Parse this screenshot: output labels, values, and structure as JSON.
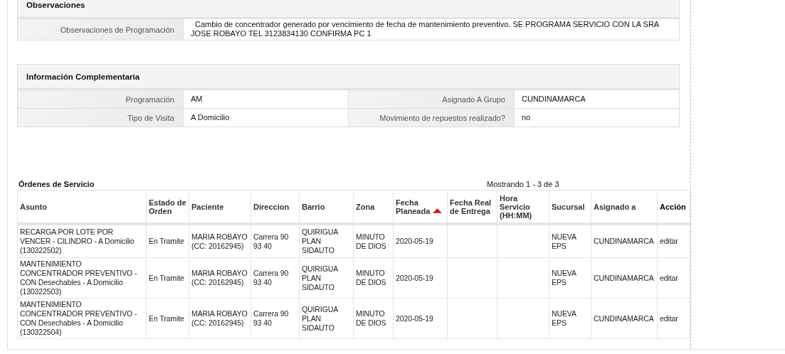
{
  "observaciones": {
    "title": "Observaciones",
    "fields": [
      {
        "label": "Observaciones de Programación",
        "value": "Cambio de concentrador generado por vencimiento de fecha de mantenimiento preventivo. SE PROGRAMA SERVICIO CON LA SRA JOSE ROBAYO TEL 3123834130 CONFIRMA PC 1"
      }
    ]
  },
  "informacion_complementaria": {
    "title": "Información Complementaria",
    "fields": [
      {
        "label": "Programación",
        "value": "AM"
      },
      {
        "label": "Asignado A Grupo",
        "value": "CUNDINAMARCA"
      },
      {
        "label": "Tipo de Visita",
        "value": "A Domicilio"
      },
      {
        "label": "Movimiento de repuestos realizado?",
        "value": "no"
      }
    ]
  },
  "ordenes": {
    "title": "Órdenes de Servicio",
    "pagination": "Mostrando 1 - 3 de 3",
    "columns": [
      {
        "label": "Asunto",
        "sortable": true,
        "sorted": false
      },
      {
        "label": "Estado de Orden",
        "sortable": true,
        "sorted": false
      },
      {
        "label": "Paciente",
        "sortable": true,
        "sorted": false
      },
      {
        "label": "Direccion",
        "sortable": true,
        "sorted": false
      },
      {
        "label": "Barrio",
        "sortable": true,
        "sorted": false
      },
      {
        "label": "Zona",
        "sortable": true,
        "sorted": false
      },
      {
        "label": "Fecha Planeada",
        "sortable": true,
        "sorted": true
      },
      {
        "label": "Fecha Real de Entrega",
        "sortable": true,
        "sorted": false
      },
      {
        "label": "Hora Servicio (HH:MM)",
        "sortable": true,
        "sorted": false
      },
      {
        "label": "Sucursal",
        "sortable": true,
        "sorted": false
      },
      {
        "label": "Asignado a",
        "sortable": true,
        "sorted": false
      },
      {
        "label": "Acción",
        "sortable": false,
        "sorted": false
      }
    ],
    "rows": [
      [
        "RECARGA POR LOTE POR VENCER - CILINDRO - A Domicilio (130322502)",
        "En Tramite",
        "MARIA ROBAYO (CC: 20162945)",
        "Carrera 90 93 40",
        "QUIRIGUA PLAN SIDAUTO",
        "MINUTO DE DIOS",
        "2020-05-19",
        "",
        "",
        "NUEVA EPS",
        "CUNDINAMARCA",
        "editar"
      ],
      [
        "MANTENIMIENTO CONCENTRADOR PREVENTIVO - CON Desechables - A Domicilio (130322503)",
        "En Tramite",
        "MARIA ROBAYO (CC: 20162945)",
        "Carrera 90 93 40",
        "QUIRIGUA PLAN SIDAUTO",
        "MINUTO DE DIOS",
        "2020-05-19",
        "",
        "",
        "NUEVA EPS",
        "CUNDINAMARCA",
        "editar"
      ],
      [
        "MANTENIMIENTO CONCENTRADOR PREVENTIVO - CON Desechables - A Domicilio (130322504)",
        "En Tramite",
        "MARIA ROBAYO (CC: 20162945)",
        "Carrera 90 93 40",
        "QUIRIGUA PLAN SIDAUTO",
        "MINUTO DE DIOS",
        "2020-05-19",
        "",
        "",
        "NUEVA EPS",
        "CUNDINAMARCA",
        "editar"
      ]
    ]
  }
}
